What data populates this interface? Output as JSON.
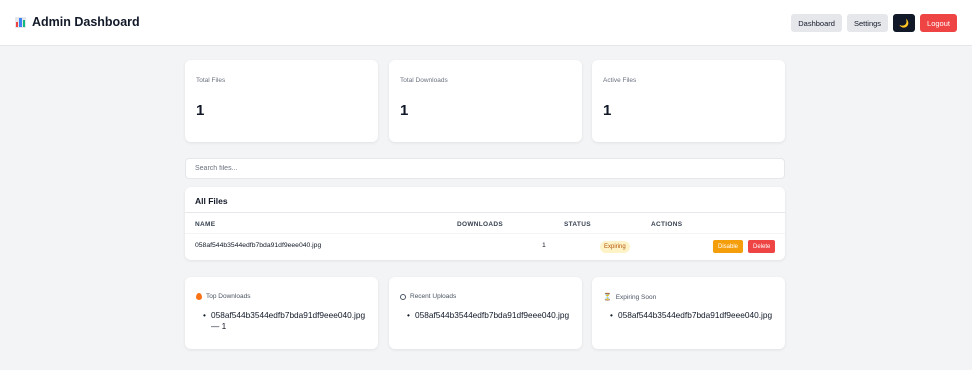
{
  "header": {
    "title": "Admin Dashboard",
    "nav": {
      "dashboard_label": "Dashboard",
      "settings_label": "Settings",
      "theme_toggle_glyph": "🌙",
      "logout_label": "Logout"
    }
  },
  "stats": [
    {
      "label": "Total Files",
      "value": "1"
    },
    {
      "label": "Total Downloads",
      "value": "1"
    },
    {
      "label": "Active Files",
      "value": "1"
    }
  ],
  "search": {
    "placeholder": "Search files...",
    "value": ""
  },
  "files_table": {
    "title": "All Files",
    "columns": [
      "NAME",
      "DOWNLOADS",
      "STATUS",
      "ACTIONS"
    ],
    "rows": [
      {
        "name": "058af544b3544edfb7bda91df9eee040.jpg",
        "downloads": "1",
        "status": "Expiring",
        "actions": [
          "Disable",
          "Delete"
        ]
      }
    ]
  },
  "panels": {
    "top_downloads": {
      "title": "Top Downloads",
      "icon": "fire-icon",
      "items": [
        "058af544b3544edfb7bda91df9eee040.jpg — 1"
      ]
    },
    "recent_uploads": {
      "title": "Recent Uploads",
      "icon": "clock-icon",
      "items": [
        "058af544b3544edfb7bda91df9eee040.jpg"
      ]
    },
    "expiring_soon": {
      "title": "Expiring Soon",
      "icon": "hourglass-icon",
      "items": [
        "058af544b3544edfb7bda91df9eee040.jpg"
      ]
    }
  },
  "colors": {
    "background": "#f3f4f6",
    "danger": "#ef4444",
    "warning": "#f59e0b",
    "badge_bg": "#fef3c7",
    "badge_text": "#b45309",
    "dark_button": "#111827"
  }
}
